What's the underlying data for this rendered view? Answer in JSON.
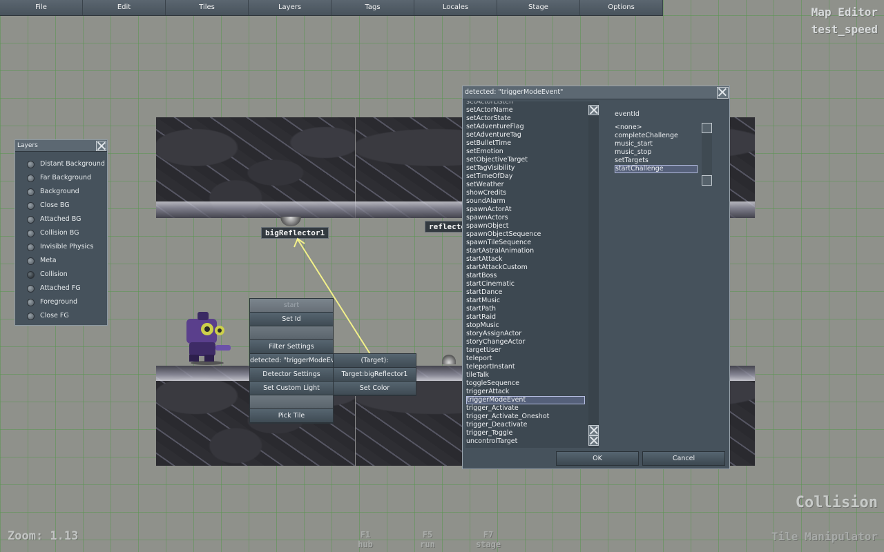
{
  "menubar": [
    "File",
    "Edit",
    "Tiles",
    "Layers",
    "Tags",
    "Locales",
    "Stage",
    "Options"
  ],
  "hud": {
    "editor_title": "Map Editor",
    "map_name": "test_speed",
    "current_layer": "Collision",
    "zoom": "Zoom: 1.13",
    "tool": "Tile Manipulator",
    "shortcuts": [
      {
        "key": "F1",
        "label": "hub"
      },
      {
        "key": "F5",
        "label": "run"
      },
      {
        "key": "F7",
        "label": "stage"
      }
    ]
  },
  "scene": {
    "actor_labels": [
      "bigReflector1",
      "reflecto"
    ]
  },
  "layers_panel": {
    "title": "Layers",
    "items": [
      {
        "label": "Distant Background",
        "selected": false
      },
      {
        "label": "Far Background",
        "selected": false
      },
      {
        "label": "Background",
        "selected": false
      },
      {
        "label": "Close BG",
        "selected": false
      },
      {
        "label": "Attached BG",
        "selected": false
      },
      {
        "label": "Collision BG",
        "selected": false
      },
      {
        "label": "Invisible Physics",
        "selected": false
      },
      {
        "label": "Meta",
        "selected": false
      },
      {
        "label": "Collision",
        "selected": true
      },
      {
        "label": "Attached FG",
        "selected": false
      },
      {
        "label": "Foreground",
        "selected": false
      },
      {
        "label": "Close FG",
        "selected": false
      }
    ]
  },
  "context_menu": {
    "header": "start",
    "set_id": "Set Id",
    "filter_settings": "Filter Settings",
    "detected": "detected: \"triggerModeEvent\"",
    "detector_settings": "Detector Settings",
    "set_custom_light": "Set Custom Light",
    "pick_tile": "Pick Tile",
    "target_header": "(Target):",
    "target": "Target:bigReflector1",
    "set_color": "Set Color"
  },
  "dialog": {
    "title": "detected: \"triggerModeEvent\"",
    "partial_first": "setActorListen",
    "events": [
      "setActorName",
      "setActorState",
      "setAdventureFlag",
      "setAdventureTag",
      "setBulletTime",
      "setEmotion",
      "setObjectiveTarget",
      "setTagVisibility",
      "setTimeOfDay",
      "setWeather",
      "showCredits",
      "soundAlarm",
      "spawnActorAt",
      "spawnActors",
      "spawnObject",
      "spawnObjectSequence",
      "spawnTileSequence",
      "startAstralAnimation",
      "startAttack",
      "startAttackCustom",
      "startBoss",
      "startCinematic",
      "startDance",
      "startMusic",
      "startPath",
      "startRaid",
      "stopMusic",
      "storyAssignActor",
      "storyChangeActor",
      "targetUser",
      "teleport",
      "teleportInstant",
      "tileTalk",
      "toggleSequence",
      "triggerAttack",
      "triggerModeEvent",
      "trigger_Activate",
      "trigger_Activate_Oneshot",
      "trigger_Deactivate",
      "trigger_Toggle",
      "uncontrolTarget"
    ],
    "selected_event": "triggerModeEvent",
    "param_label": "eventId",
    "options": [
      "<none>",
      "completeChallenge",
      "music_start",
      "music_stop",
      "setTargets",
      "startChallenge"
    ],
    "selected_option": "startChallenge",
    "ok_label": "OK",
    "cancel_label": "Cancel"
  }
}
